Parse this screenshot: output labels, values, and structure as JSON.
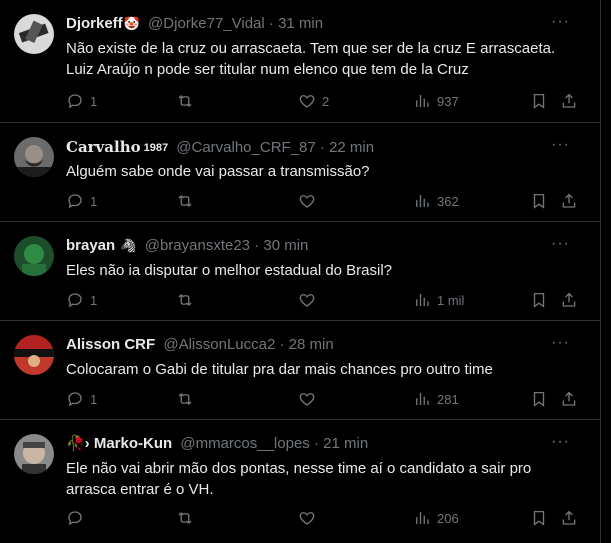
{
  "tweets": [
    {
      "name": "Djorkeff",
      "badge": "🤡",
      "handle": "@Djorke77_Vidal",
      "dot": "·",
      "time": "31 min",
      "text": "Não existe de la cruz ou arrascaeta. Tem que ser de la cruz E arrascaeta.\nLuiz Araújo n pode ser titular num elenco que tem de la Cruz",
      "replies": "1",
      "retweets": "",
      "likes": "2",
      "views": "937"
    },
    {
      "name": "Carvalho",
      "badge": "1987",
      "handle": "@Carvalho_CRF_87",
      "dot": "·",
      "time": "22 min",
      "text": "Alguém sabe onde vai passar a transmissão?",
      "replies": "1",
      "retweets": "",
      "likes": "",
      "views": "362"
    },
    {
      "name": "brayan",
      "badge": "🦓",
      "handle": "@brayansxte23",
      "dot": "·",
      "time": "30 min",
      "text": "Eles não ia disputar o melhor estadual do Brasil?",
      "replies": "1",
      "retweets": "",
      "likes": "",
      "views": "1 mil"
    },
    {
      "name": "Alisson CRF",
      "badge": "",
      "handle": "@AlissonLucca2",
      "dot": "·",
      "time": "28 min",
      "text": "Colocaram o Gabi de titular pra dar mais chances pro outro time",
      "replies": "1",
      "retweets": "",
      "likes": "",
      "views": "281"
    },
    {
      "name": "🥀› Marko-Kun",
      "badge": "",
      "handle": "@mmarcos__lopes",
      "dot": "·",
      "time": "21 min",
      "text": "Ele não vai abrir mão dos pontas, nesse time aí o candidato a sair pro\narrasca entrar é o VH.",
      "replies": "",
      "retweets": "",
      "likes": "",
      "views": "206"
    }
  ],
  "more_label": "···",
  "colors": {
    "background": "#000000",
    "text": "#e7e9ea",
    "muted": "#71767b",
    "divider": "#2f3336"
  },
  "icons": [
    "reply-icon",
    "retweet-icon",
    "like-icon",
    "views-icon",
    "bookmark-icon",
    "share-icon",
    "more-icon"
  ]
}
